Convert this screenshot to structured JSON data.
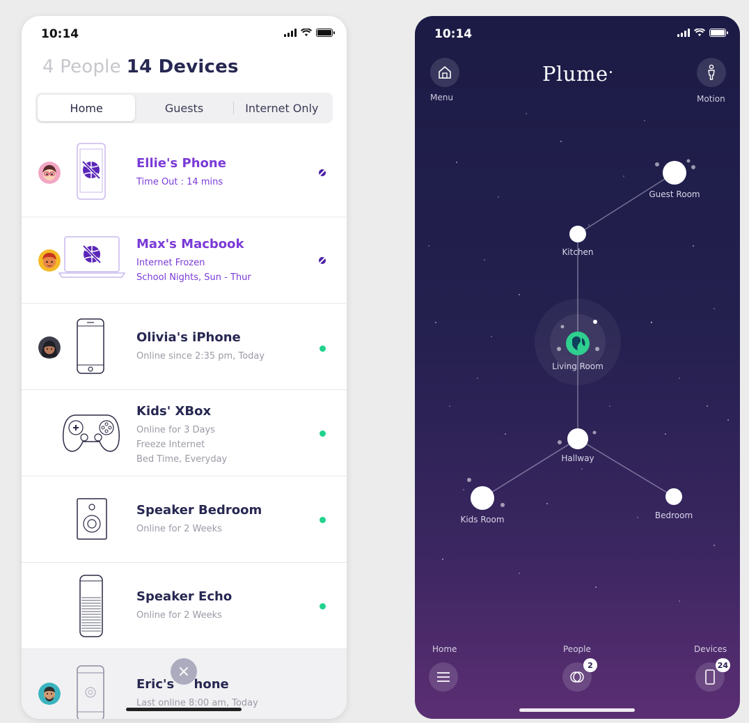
{
  "left_screen": {
    "status": {
      "time": "10:14"
    },
    "header": {
      "people_count": "4 People",
      "devices_count": "14 Devices"
    },
    "tabs": [
      {
        "label": "Home",
        "active": true
      },
      {
        "label": "Guests",
        "active": false
      },
      {
        "label": "Internet Only",
        "active": false
      }
    ],
    "devices": [
      {
        "name": "Ellie's Phone",
        "lines": [
          "Time Out : 14 mins"
        ],
        "status": "paused",
        "icon": "phone-blocked-icon",
        "avatar": "girl-avatar"
      },
      {
        "name": "Max's Macbook",
        "lines": [
          "Internet Frozen",
          "School Nights, Sun - Thur"
        ],
        "status": "paused",
        "icon": "laptop-blocked-icon",
        "avatar": "boy-avatar"
      },
      {
        "name": "Olivia's iPhone",
        "lines": [
          "Online since 2:35 pm, Today"
        ],
        "status": "online",
        "icon": "iphone-icon",
        "avatar": "woman-avatar"
      },
      {
        "name": "Kids' XBox",
        "lines": [
          "Online for 3 Days",
          "Freeze Internet",
          "Bed Time, Everyday"
        ],
        "status": "online",
        "icon": "gamepad-icon",
        "avatar": ""
      },
      {
        "name": "Speaker Bedroom",
        "lines": [
          "Online for 2 Weeks"
        ],
        "status": "online",
        "icon": "speaker-icon",
        "avatar": ""
      },
      {
        "name": "Speaker Echo",
        "lines": [
          "Online for 2 Weeks"
        ],
        "status": "online",
        "icon": "echo-speaker-icon",
        "avatar": ""
      },
      {
        "name": "Eric's iPhone",
        "name_visible": "Eric's ",
        "name_tail": "hone",
        "lines": [
          "Last online 8:00 am, Today"
        ],
        "status": "offline",
        "icon": "iphone-icon",
        "avatar": "man-avatar"
      }
    ],
    "close_label": "×",
    "colors": {
      "accent_purple": "#7a3ad6",
      "online_green": "#21d28c",
      "heading_navy": "#272752"
    }
  },
  "right_screen": {
    "status": {
      "time": "10:14"
    },
    "brand": "Plume",
    "menu_label": "Menu",
    "motion_label": "Motion",
    "nodes": [
      {
        "label": "Guest Room"
      },
      {
        "label": "Kitchen"
      },
      {
        "label": "Living Room"
      },
      {
        "label": "Hallway"
      },
      {
        "label": "Kids Room"
      },
      {
        "label": "Bedroom"
      }
    ],
    "bottom_nav": {
      "home_label": "Home",
      "people_label": "People",
      "people_badge": "2",
      "devices_label": "Devices",
      "devices_badge": "24"
    },
    "colors": {
      "bg_top": "#1c1b45",
      "bg_bottom": "#5b2e73",
      "internet_node": "#2fcf8f"
    }
  }
}
